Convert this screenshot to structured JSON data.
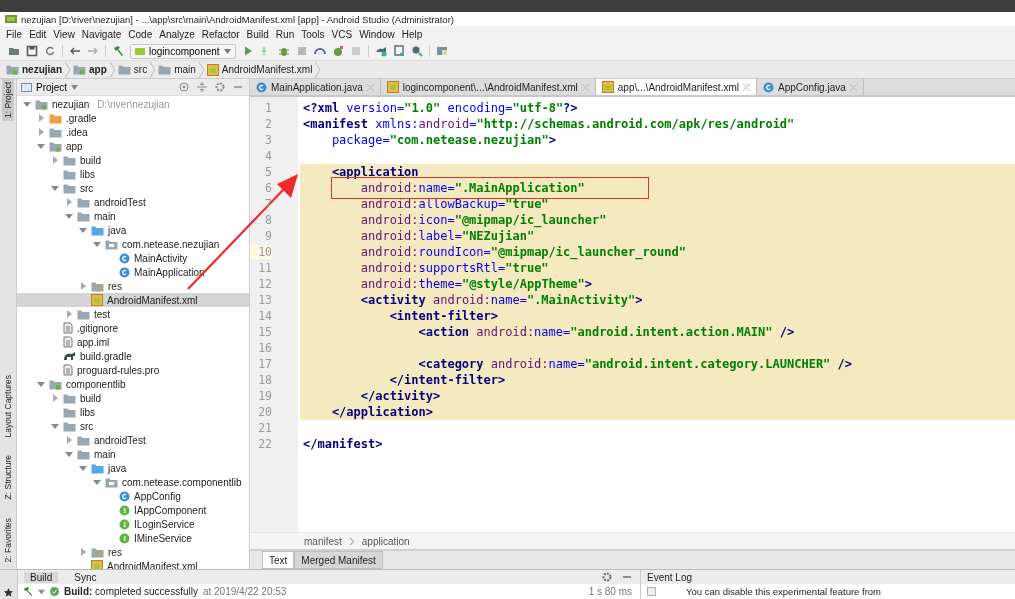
{
  "window": {
    "title": "nezujian [D:\\river\\nezujian] - ...\\app\\src\\main\\AndroidManifest.xml [app] - Android Studio (Administrator)"
  },
  "menu": [
    "File",
    "Edit",
    "View",
    "Navigate",
    "Code",
    "Analyze",
    "Refactor",
    "Build",
    "Run",
    "Tools",
    "VCS",
    "Window",
    "Help"
  ],
  "toolbar": {
    "run_config": "logincomponent"
  },
  "nav_bar": [
    {
      "label": "nezujian",
      "kind": "module"
    },
    {
      "label": "app",
      "kind": "module"
    },
    {
      "label": "src",
      "kind": "folder"
    },
    {
      "label": "main",
      "kind": "folder"
    },
    {
      "label": "AndroidManifest.xml",
      "kind": "manifest"
    }
  ],
  "tool_strip": [
    {
      "label": "1: Project",
      "selected": true
    },
    {
      "label": "Layout Captures",
      "selected": false
    },
    {
      "label": "Z: Structure",
      "selected": false
    },
    {
      "label": "2: Favorites",
      "selected": false
    }
  ],
  "project_panel": {
    "title": "Project",
    "tree": [
      {
        "label": "nezujian",
        "note": "D:\\river\\nezujian",
        "kind": "module",
        "expanded": true,
        "selected": false,
        "children": [
          {
            "label": ".gradle",
            "kind": "folder-orange",
            "expanded": false,
            "selected": false
          },
          {
            "label": ".idea",
            "kind": "folder",
            "expanded": false,
            "selected": false
          },
          {
            "label": "app",
            "kind": "module",
            "expanded": true,
            "selected": false,
            "children": [
              {
                "label": "build",
                "kind": "folder",
                "expanded": false,
                "selected": false
              },
              {
                "label": "libs",
                "kind": "folder",
                "selected": false
              },
              {
                "label": "src",
                "kind": "folder",
                "expanded": true,
                "selected": false,
                "children": [
                  {
                    "label": "androidTest",
                    "kind": "folder",
                    "expanded": false,
                    "selected": false
                  },
                  {
                    "label": "main",
                    "kind": "folder",
                    "expanded": true,
                    "selected": false,
                    "children": [
                      {
                        "label": "java",
                        "kind": "folder-blue",
                        "expanded": true,
                        "selected": false,
                        "children": [
                          {
                            "label": "com.netease.nezujian",
                            "kind": "package",
                            "expanded": true,
                            "selected": false,
                            "children": [
                              {
                                "label": "MainActivity",
                                "kind": "class",
                                "selected": false
                              },
                              {
                                "label": "MainApplication",
                                "kind": "class",
                                "selected": false
                              }
                            ]
                          }
                        ]
                      },
                      {
                        "label": "res",
                        "kind": "res",
                        "expanded": false,
                        "selected": false
                      },
                      {
                        "label": "AndroidManifest.xml",
                        "kind": "manifest",
                        "selected": true
                      }
                    ]
                  },
                  {
                    "label": "test",
                    "kind": "folder",
                    "expanded": false,
                    "selected": false
                  }
                ]
              },
              {
                "label": ".gitignore",
                "kind": "file",
                "selected": false
              },
              {
                "label": "app.iml",
                "kind": "file",
                "selected": false
              },
              {
                "label": "build.gradle",
                "kind": "gradle",
                "selected": false
              },
              {
                "label": "proguard-rules.pro",
                "kind": "file",
                "selected": false
              }
            ]
          },
          {
            "label": "componentlib",
            "kind": "module",
            "expanded": true,
            "selected": false,
            "children": [
              {
                "label": "build",
                "kind": "folder",
                "expanded": false,
                "selected": false
              },
              {
                "label": "libs",
                "kind": "folder",
                "selected": false
              },
              {
                "label": "src",
                "kind": "folder",
                "expanded": true,
                "selected": false,
                "children": [
                  {
                    "label": "androidTest",
                    "kind": "folder",
                    "expanded": false,
                    "selected": false
                  },
                  {
                    "label": "main",
                    "kind": "folder",
                    "expanded": true,
                    "selected": false,
                    "children": [
                      {
                        "label": "java",
                        "kind": "folder-blue",
                        "expanded": true,
                        "selected": false,
                        "children": [
                          {
                            "label": "com.netease.componentlib",
                            "kind": "package",
                            "expanded": true,
                            "selected": false,
                            "children": [
                              {
                                "label": "AppConfig",
                                "kind": "class",
                                "selected": false
                              },
                              {
                                "label": "IAppComponent",
                                "kind": "interface",
                                "selected": false
                              },
                              {
                                "label": "ILoginService",
                                "kind": "interface",
                                "selected": false
                              },
                              {
                                "label": "IMineService",
                                "kind": "interface",
                                "selected": false
                              }
                            ]
                          }
                        ]
                      },
                      {
                        "label": "res",
                        "kind": "res",
                        "expanded": false,
                        "selected": false
                      },
                      {
                        "label": "AndroidManifest.xml",
                        "kind": "manifest",
                        "selected": false
                      }
                    ]
                  }
                ]
              }
            ]
          }
        ]
      }
    ]
  },
  "editor_tabs": [
    {
      "label": "MainApplication.java",
      "kind": "class",
      "selected": false
    },
    {
      "label": "logincomponent\\...\\AndroidManifest.xml",
      "kind": "manifest",
      "selected": false
    },
    {
      "label": "app\\...\\AndroidManifest.xml",
      "kind": "manifest",
      "selected": true
    },
    {
      "label": "AppConfig.java",
      "kind": "class",
      "selected": false
    }
  ],
  "code": [
    {
      "number": "1",
      "highlighted": false,
      "current": false,
      "tokens": [
        {
          "kind": "tag",
          "text": "<?xml "
        },
        {
          "kind": "attr",
          "text": "version="
        },
        {
          "kind": "value",
          "text": "\"1.0\""
        },
        {
          "kind": "attr",
          "text": " encoding="
        },
        {
          "kind": "value",
          "text": "\"utf-8\""
        },
        {
          "kind": "tag",
          "text": "?>"
        }
      ]
    },
    {
      "number": "2",
      "highlighted": false,
      "current": false,
      "tokens": [
        {
          "kind": "tag",
          "text": "<manifest "
        },
        {
          "kind": "attr",
          "text": "xmlns:"
        },
        {
          "kind": "ns",
          "text": "android"
        },
        {
          "kind": "attr",
          "text": "="
        },
        {
          "kind": "value",
          "text": "\"http://schemas.android.com/apk/res/android\""
        }
      ],
      "children": [
        {
          "number": "3",
          "highlighted": false,
          "current": false,
          "tokens": [
            {
              "kind": "attr",
              "text": "package="
            },
            {
              "kind": "value",
              "text": "\"com.netease.nezujian\""
            },
            {
              "kind": "tag",
              "text": ">"
            }
          ]
        },
        {
          "number": "4",
          "highlighted": false,
          "current": false
        },
        {
          "number": "5",
          "highlighted": true,
          "current": false,
          "tokens": [
            {
              "kind": "tag",
              "text": "<application"
            }
          ],
          "children": [
            {
              "number": "6",
              "highlighted": true,
              "current": false,
              "tokens": [
                {
                  "kind": "ns",
                  "text": "android:"
                },
                {
                  "kind": "attr",
                  "text": "name="
                },
                {
                  "kind": "value",
                  "text": "\".MainApplication\""
                }
              ]
            },
            {
              "number": "7",
              "highlighted": true,
              "current": false,
              "tokens": [
                {
                  "kind": "ns",
                  "text": "android:"
                },
                {
                  "kind": "attr",
                  "text": "allowBackup="
                },
                {
                  "kind": "value",
                  "text": "\"true\""
                }
              ]
            },
            {
              "number": "8",
              "highlighted": true,
              "current": false,
              "tokens": [
                {
                  "kind": "ns",
                  "text": "android:"
                },
                {
                  "kind": "attr",
                  "text": "icon="
                },
                {
                  "kind": "value",
                  "text": "\"@mipmap/ic_launcher\""
                }
              ]
            },
            {
              "number": "9",
              "highlighted": true,
              "current": false,
              "tokens": [
                {
                  "kind": "ns",
                  "text": "android:"
                },
                {
                  "kind": "attr",
                  "text": "label="
                },
                {
                  "kind": "value",
                  "text": "\"NEZujian\""
                }
              ]
            },
            {
              "number": "10",
              "highlighted": true,
              "current": true,
              "tokens": [
                {
                  "kind": "ns",
                  "text": "android:"
                },
                {
                  "kind": "attr",
                  "text": "roundIcon="
                },
                {
                  "kind": "value",
                  "text": "\"@mipmap/ic_launcher_round\""
                }
              ]
            },
            {
              "number": "11",
              "highlighted": true,
              "current": false,
              "tokens": [
                {
                  "kind": "ns",
                  "text": "android:"
                },
                {
                  "kind": "attr",
                  "text": "supportsRtl="
                },
                {
                  "kind": "value",
                  "text": "\"true\""
                }
              ]
            },
            {
              "number": "12",
              "highlighted": true,
              "current": false,
              "tokens": [
                {
                  "kind": "ns",
                  "text": "android:"
                },
                {
                  "kind": "attr",
                  "text": "theme="
                },
                {
                  "kind": "value",
                  "text": "\"@style/AppTheme\""
                },
                {
                  "kind": "tag",
                  "text": ">"
                }
              ]
            },
            {
              "number": "13",
              "highlighted": true,
              "current": false,
              "tokens": [
                {
                  "kind": "tag",
                  "text": "<activity "
                },
                {
                  "kind": "ns",
                  "text": "android:"
                },
                {
                  "kind": "attr",
                  "text": "name="
                },
                {
                  "kind": "value",
                  "text": "\".MainActivity\""
                },
                {
                  "kind": "tag",
                  "text": ">"
                }
              ],
              "children": [
                {
                  "number": "14",
                  "highlighted": true,
                  "current": false,
                  "tokens": [
                    {
                      "kind": "tag",
                      "text": "<intent-filter>"
                    }
                  ],
                  "children": [
                    {
                      "number": "15",
                      "highlighted": true,
                      "current": false,
                      "tokens": [
                        {
                          "kind": "tag",
                          "text": "<action "
                        },
                        {
                          "kind": "ns",
                          "text": "android:"
                        },
                        {
                          "kind": "attr",
                          "text": "name="
                        },
                        {
                          "kind": "value",
                          "text": "\"android.intent.action.MAIN\""
                        },
                        {
                          "kind": "tag",
                          "text": " />"
                        }
                      ]
                    },
                    {
                      "number": "16",
                      "highlighted": true,
                      "current": false
                    },
                    {
                      "number": "17",
                      "highlighted": true,
                      "current": false,
                      "tokens": [
                        {
                          "kind": "tag",
                          "text": "<category "
                        },
                        {
                          "kind": "ns",
                          "text": "android:"
                        },
                        {
                          "kind": "attr",
                          "text": "name="
                        },
                        {
                          "kind": "value",
                          "text": "\"android.intent.category.LAUNCHER\""
                        },
                        {
                          "kind": "tag",
                          "text": " />"
                        }
                      ]
                    }
                  ]
                },
                {
                  "number": "18",
                  "highlighted": true,
                  "current": false,
                  "tokens": [
                    {
                      "kind": "tag",
                      "text": "</intent-filter>"
                    }
                  ]
                }
              ]
            },
            {
              "number": "19",
              "highlighted": true,
              "current": false,
              "tokens": [
                {
                  "kind": "tag",
                  "text": "</activity>"
                }
              ]
            }
          ]
        },
        {
          "number": "20",
          "highlighted": true,
          "current": false,
          "tokens": [
            {
              "kind": "tag",
              "text": "</application>"
            }
          ]
        }
      ]
    },
    {
      "number": "21",
      "highlighted": false,
      "current": false
    },
    {
      "number": "22",
      "highlighted": false,
      "current": false,
      "tokens": [
        {
          "kind": "tag",
          "text": "</manifest>"
        }
      ]
    }
  ],
  "editor_breadcrumb": [
    "manifest",
    "application"
  ],
  "editor_bottom_tabs": [
    {
      "label": "Text",
      "selected": true
    },
    {
      "label": "Merged Manifest",
      "selected": false
    }
  ],
  "build_panel": {
    "tabs": [
      {
        "label": "Build",
        "selected": true
      },
      {
        "label": "Sync",
        "selected": false
      }
    ],
    "status": "**Build:** completed successfully",
    "time": "at 2019/4/22 20:53",
    "duration": "1 s 80 ms"
  },
  "event_log": {
    "title": "Event Log",
    "message": "You can disable this experimental feature from"
  }
}
